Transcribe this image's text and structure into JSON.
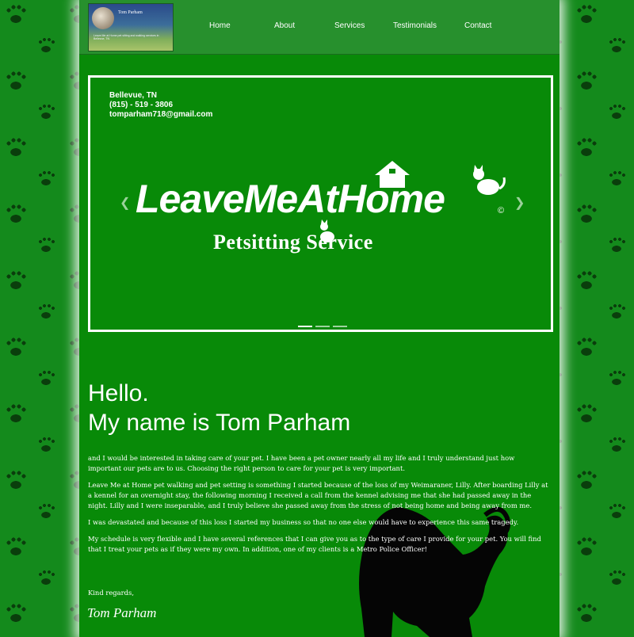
{
  "header": {
    "logo": {
      "name": "Tom Parham",
      "tagline": "Leave Me at Home pet sitting and walking services in Bellevue, TN"
    },
    "nav": [
      {
        "label": "Home"
      },
      {
        "label": "About"
      },
      {
        "label": "Services"
      },
      {
        "label": "Testimonials"
      },
      {
        "label": "Contact"
      }
    ]
  },
  "slider": {
    "contact": {
      "location": "Bellevue, TN",
      "phone": "(815) - 519 - 3806",
      "email": "tomparham718@gmail.com"
    },
    "brand": "LeaveMeAtHome",
    "copyright": "©",
    "subtitle": "Petsitting Service",
    "prev_icon": "chevron-left-icon",
    "next_icon": "chevron-right-icon",
    "slide_count": 3,
    "active_slide": 1
  },
  "main": {
    "greeting_line1": "Hello.",
    "greeting_line2": "My name is Tom Parham",
    "paragraphs": [
      "and I would be interested in taking care of your pet. I have been a pet owner nearly all my life and I truly understand just how important our pets are to us. Choosing the right person to care for your pet is very important.",
      "Leave Me at Home pet walking and pet setting is something I started because of the loss of my Weimaraner, Lilly. After boarding Lilly at a kennel for an overnight stay, the following morning I received a call from the kennel advising me that she had passed away in the night. Lilly and I were inseparable, and I truly believe she passed away from the stress of not being home and being away from me.",
      "I was devastated and because of this loss I started my business so that no one else would have to experience this same tragedy.",
      "My schedule is very flexible and I have several references that I can give you as to the type of care I provide for your pet. You will find that I treat your pets as if they were my own. In addition, one of my clients is a Metro Police Officer!"
    ],
    "closing": "Kind regards,",
    "signature": "Tom Parham"
  },
  "colors": {
    "background": "#148a1c",
    "paw": "#0a3e0c",
    "content": "#088a08",
    "header": "#27902d",
    "text": "#ffffff"
  }
}
